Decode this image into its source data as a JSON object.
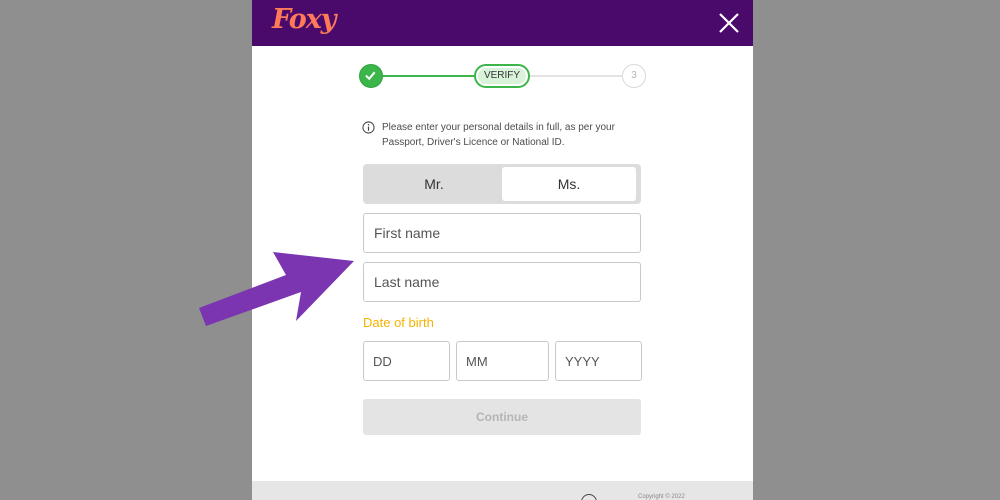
{
  "header": {
    "logo_text": "Foxy",
    "background": "#4a0a6b",
    "close_icon": "close-icon"
  },
  "stepper": {
    "step1_icon": "check-icon",
    "step2_label": "VERIFY",
    "step3_label": "3",
    "accent": "#3cb54a"
  },
  "info": {
    "icon": "info-icon",
    "text": "Please enter your personal details in full, as per your Passport, Driver's Licence or National ID."
  },
  "title_toggle": {
    "options": [
      "Mr.",
      "Ms."
    ],
    "selected": "Ms."
  },
  "fields": {
    "first_name_placeholder": "First name",
    "last_name_placeholder": "Last name"
  },
  "dob": {
    "label": "Date of birth",
    "label_color": "#f5b400",
    "day_placeholder": "DD",
    "month_placeholder": "MM",
    "year_placeholder": "YYYY"
  },
  "continue_label": "Continue",
  "footer": {
    "text": "Copyright © 2022"
  },
  "annotation": {
    "arrow_icon": "arrow-icon",
    "arrow_color": "#7b35b0"
  }
}
